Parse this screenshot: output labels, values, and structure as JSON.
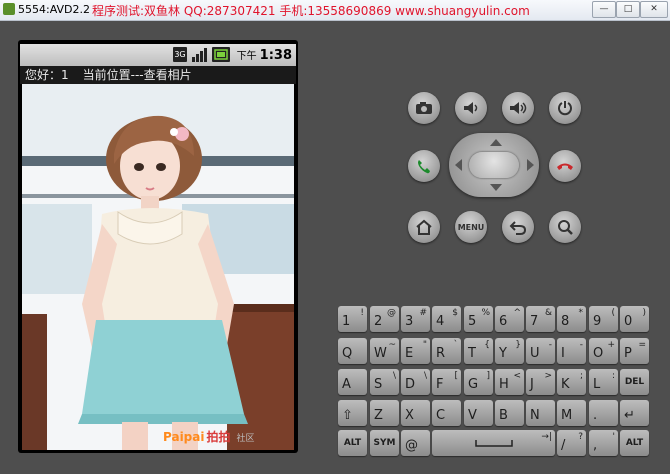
{
  "window": {
    "title": "5554:AVD2.2",
    "banner": "程序测试:双鱼林 QQ:287307421 手机:13558690869 www.shuangyulin.com",
    "minimize_label": "—",
    "maximize_label": "□",
    "close_label": "✕"
  },
  "statusbar": {
    "network_label": "3G",
    "ampm": "下午",
    "time": "1:38",
    "icons": [
      "network-3g-icon",
      "signal-icon",
      "battery-icon"
    ]
  },
  "app": {
    "greeting": "您好：1",
    "location": "当前位置---查看相片"
  },
  "photo": {
    "watermark_brand": "Paipai",
    "watermark_cn": "拍拍",
    "watermark_sub": "社区"
  },
  "controls": {
    "menu_label": "MENU",
    "icons": [
      "camera-icon",
      "volume-down-icon",
      "volume-up-icon",
      "power-icon",
      "call-icon",
      "end-call-icon",
      "home-icon",
      "back-icon",
      "search-icon"
    ]
  },
  "keyboard": {
    "rows": [
      [
        {
          "main": "1",
          "alt": "!"
        },
        {
          "main": "2",
          "alt": "@"
        },
        {
          "main": "3",
          "alt": "#"
        },
        {
          "main": "4",
          "alt": "$"
        },
        {
          "main": "5",
          "alt": "%"
        },
        {
          "main": "6",
          "alt": "^"
        },
        {
          "main": "7",
          "alt": "&"
        },
        {
          "main": "8",
          "alt": "*"
        },
        {
          "main": "9",
          "alt": "("
        },
        {
          "main": "0",
          "alt": ")"
        }
      ],
      [
        {
          "main": "Q",
          "alt": ""
        },
        {
          "main": "W",
          "alt": "~"
        },
        {
          "main": "E",
          "alt": "\""
        },
        {
          "main": "R",
          "alt": "`"
        },
        {
          "main": "T",
          "alt": "{"
        },
        {
          "main": "Y",
          "alt": "}"
        },
        {
          "main": "U",
          "alt": "-"
        },
        {
          "main": "I",
          "alt": "-"
        },
        {
          "main": "O",
          "alt": "+"
        },
        {
          "main": "P",
          "alt": "="
        }
      ],
      [
        {
          "main": "A",
          "alt": ""
        },
        {
          "main": "S",
          "alt": "\\"
        },
        {
          "main": "D",
          "alt": "\\"
        },
        {
          "main": "F",
          "alt": "["
        },
        {
          "main": "G",
          "alt": "]"
        },
        {
          "main": "H",
          "alt": "<"
        },
        {
          "main": "J",
          "alt": ">"
        },
        {
          "main": "K",
          "alt": ";"
        },
        {
          "main": "L",
          "alt": ":"
        },
        {
          "main": "DEL",
          "alt": ""
        }
      ],
      [
        {
          "main": "⇧",
          "alt": ""
        },
        {
          "main": "Z",
          "alt": ""
        },
        {
          "main": "X",
          "alt": ""
        },
        {
          "main": "C",
          "alt": ""
        },
        {
          "main": "V",
          "alt": ""
        },
        {
          "main": "B",
          "alt": ""
        },
        {
          "main": "N",
          "alt": ""
        },
        {
          "main": "M",
          "alt": ""
        },
        {
          "main": ".",
          "alt": ""
        },
        {
          "main": "↵",
          "alt": ""
        }
      ],
      [
        {
          "main": "ALT",
          "alt": ""
        },
        {
          "main": "SYM",
          "alt": ""
        },
        {
          "main": "@",
          "alt": ""
        },
        {
          "main": "space",
          "alt": "→|"
        },
        {
          "main": "/",
          "alt": "?"
        },
        {
          "main": ",",
          "alt": "'"
        },
        {
          "main": "ALT",
          "alt": ""
        }
      ]
    ]
  }
}
